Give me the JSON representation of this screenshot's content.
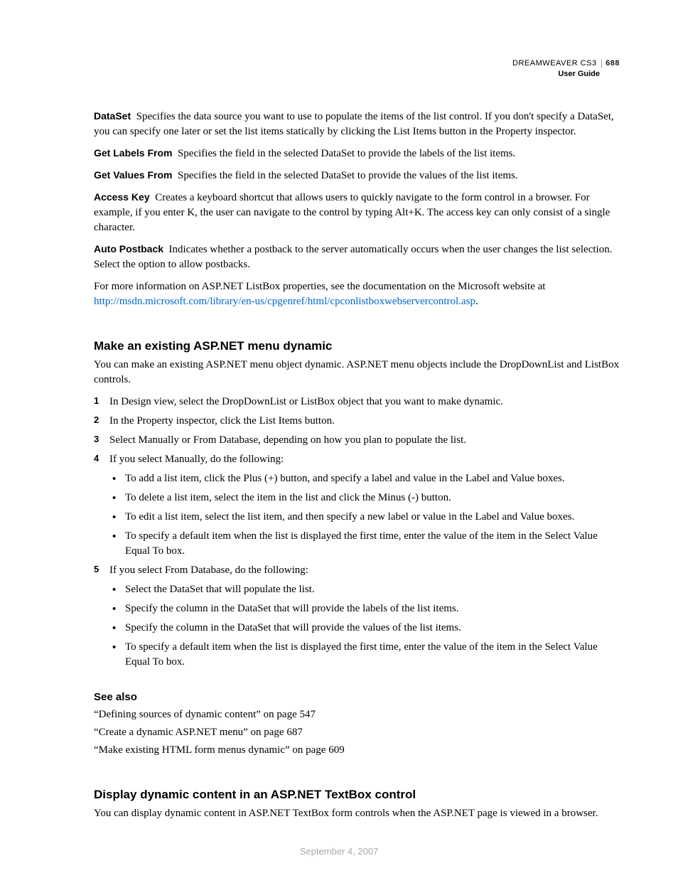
{
  "header": {
    "product": "DREAMWEAVER CS3",
    "page_number": "688",
    "subtitle": "User Guide"
  },
  "definitions": [
    {
      "term": "DataSet",
      "desc": "Specifies the data source you want to use to populate the items of the list control. If you don't specify a DataSet, you can specify one later or set the list items statically by clicking the List Items button in the Property inspector."
    },
    {
      "term": "Get Labels From",
      "desc": "Specifies the field in the selected DataSet to provide the labels of the list items."
    },
    {
      "term": "Get Values From",
      "desc": "Specifies the field in the selected DataSet to provide the values of the list items."
    },
    {
      "term": "Access Key",
      "desc": "Creates a keyboard shortcut that allows users to quickly navigate to the form control in a browser. For example, if you enter K, the user can navigate to the control by typing Alt+K. The access key can only consist of a single character."
    },
    {
      "term": "Auto Postback",
      "desc": "Indicates whether a postback to the server automatically occurs when the user changes the list selection. Select the option to allow postbacks."
    }
  ],
  "more_info": {
    "lead": "For more information on ASP.NET ListBox properties, see the documentation on the Microsoft website at ",
    "url": "http://msdn.microsoft.com/library/en-us/cpgenref/html/cpconlistboxwebservercontrol.asp",
    "tail": "."
  },
  "section1": {
    "heading": "Make an existing ASP.NET menu dynamic",
    "intro": "You can make an existing ASP.NET menu object dynamic. ASP.NET menu objects include the DropDownList and ListBox controls.",
    "steps": [
      "In Design view, select the DropDownList or ListBox object that you want to make dynamic.",
      "In the Property inspector, click the List Items button.",
      "Select Manually or From Database, depending on how you plan to populate the list.",
      "If you select Manually, do the following:",
      "If you select From Database, do the following:"
    ],
    "manual_bullets": [
      "To add a list item, click the Plus (+) button, and specify a label and value in the Label and Value boxes.",
      "To delete a list item, select the item in the list and click the Minus (-) button.",
      "To edit a list item, select the list item, and then specify a new label or value in the Label and Value boxes.",
      "To specify a default item when the list is displayed the first time, enter the value of the item in the Select Value Equal To box."
    ],
    "database_bullets": [
      "Select the DataSet that will populate the list.",
      "Specify the column in the DataSet that will provide the labels of the list items.",
      "Specify the column in the DataSet that will provide the values of the list items.",
      "To specify a default item when the list is displayed the first time, enter the value of the item in the Select Value Equal To box."
    ]
  },
  "see_also": {
    "heading": "See also",
    "items": [
      "“Defining sources of dynamic content” on page 547",
      "“Create a dynamic ASP.NET menu” on page 687",
      "“Make existing HTML form menus dynamic” on page 609"
    ]
  },
  "section2": {
    "heading": "Display dynamic content in an ASP.NET TextBox control",
    "intro": "You can display dynamic content in ASP.NET TextBox form controls when the ASP.NET page is viewed in a browser."
  },
  "footer_date": "September 4, 2007"
}
